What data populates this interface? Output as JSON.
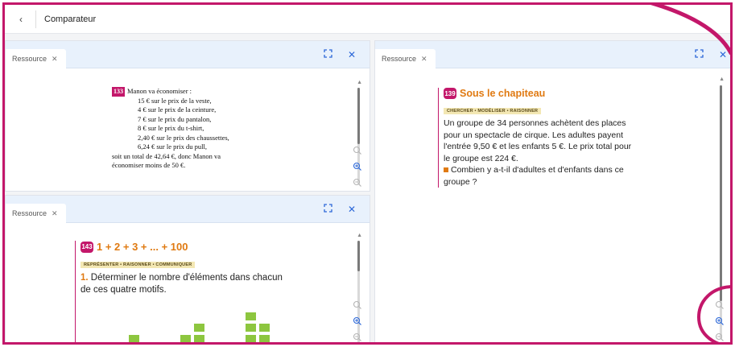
{
  "header": {
    "back_icon": "chevron-left-icon",
    "title": "Comparateur"
  },
  "accent_color": "#c3176a",
  "panes": {
    "top_left": {
      "tab_label": "Ressource",
      "content": {
        "number": "133",
        "lines": [
          "Manon va économiser :",
          "15 € sur le prix de la veste,",
          "4 € sur le prix de la ceinture,",
          "7 € sur le prix du pantalon,",
          "8 € sur le prix du t-shirt,",
          "2,40 € sur le prix des chaussettes,",
          "6,24 € sur le prix du pull,",
          "soit un total de 42,64 €, donc Manon va",
          "économiser moins de 50 €."
        ]
      }
    },
    "bottom_left": {
      "tab_label": "Ressource",
      "content": {
        "number": "143",
        "title": "1 + 2 + 3 + ... + 100",
        "skills": "REPRÉSENTER • RAISONNER • COMMUNIQUER",
        "question_number": "1.",
        "question_line1": "Déterminer le nombre d'éléments dans chacun",
        "question_line2": "de ces quatre motifs."
      }
    },
    "right": {
      "tab_label": "Ressource",
      "content": {
        "number": "139",
        "title": "Sous le chapiteau",
        "skills": "CHERCHER • MODÉLISER • RAISONNER",
        "lines": [
          "Un groupe de 34 personnes achètent des places",
          "pour un spectacle de cirque. Les adultes payent",
          "l'entrée 9,50 € et les enfants 5 €. Le prix total pour",
          "le groupe est 224 €."
        ],
        "question_line1": "Combien y a-t-il d'adultes et d'enfants dans ce",
        "question_line2": "groupe ?"
      }
    }
  },
  "icons": {
    "expand": "expand-icon",
    "close": "close-icon",
    "zoom_reset": "zoom-reset-icon",
    "zoom_in": "zoom-in-icon",
    "zoom_out": "zoom-out-icon"
  }
}
